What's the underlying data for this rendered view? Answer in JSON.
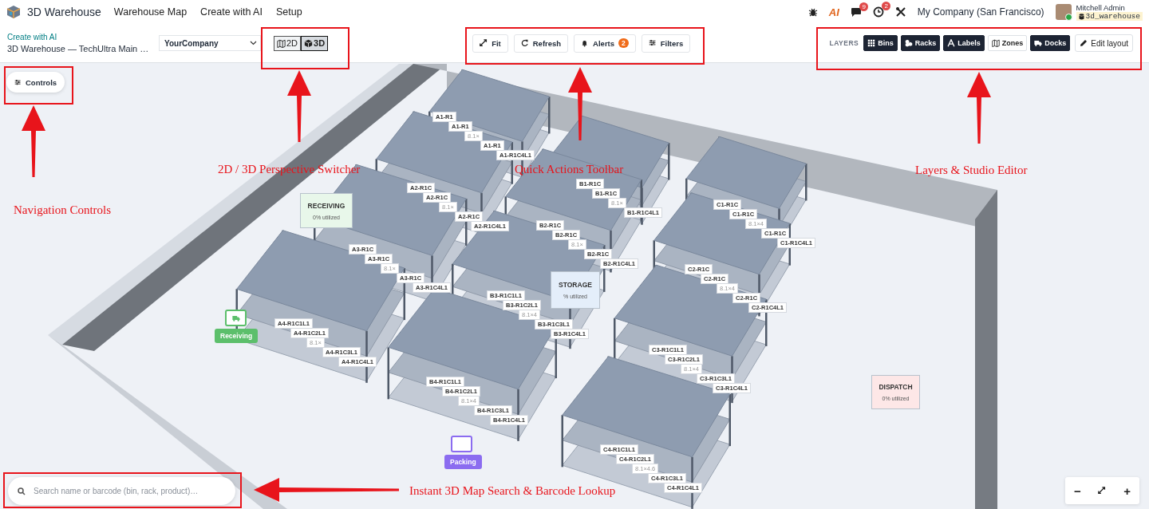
{
  "top_nav": {
    "app_name": "3D Warehouse",
    "menu": [
      {
        "label": "Warehouse Map"
      },
      {
        "label": "Create with AI"
      },
      {
        "label": "Setup"
      }
    ],
    "ai_logo": "AI",
    "messages_badge": "9",
    "activities_badge": "2",
    "company": "My Company (San Francisco)",
    "user_name": "Mitchell Admin",
    "database": "3d_warehouse"
  },
  "control_bar": {
    "breadcrumb": "Create with AI",
    "title": "3D Warehouse — TechUltra Main …",
    "company_select": "YourCompany",
    "view_modes": [
      {
        "label": "2D",
        "kind": "map",
        "selected": false
      },
      {
        "label": "3D",
        "kind": "cube",
        "selected": true
      }
    ],
    "actions": [
      {
        "label": "Fit",
        "kind": "fit"
      },
      {
        "label": "Refresh",
        "kind": "refresh"
      },
      {
        "label": "Alerts",
        "kind": "bell",
        "badge": "2"
      },
      {
        "label": "Filters",
        "kind": "filters"
      }
    ],
    "layers_label": "LAYERS",
    "layers": [
      {
        "label": "Bins",
        "kind": "grid",
        "on": true
      },
      {
        "label": "Racks",
        "kind": "cubes",
        "on": true
      },
      {
        "label": "Labels",
        "kind": "font",
        "on": true
      },
      {
        "label": "Zones",
        "kind": "map",
        "on": false
      },
      {
        "label": "Docks",
        "kind": "truck",
        "on": true
      }
    ],
    "edit_layout": "Edit layout"
  },
  "scene": {
    "controls": "Controls",
    "zones": [
      {
        "name": "RECEIVING",
        "utilization": "0% utilized",
        "color": "#e8f7ea"
      },
      {
        "name": "STORAGE",
        "utilization": "% utilized",
        "color": "#e4eefa"
      },
      {
        "name": "DISPATCH",
        "utilization": "0% utilized",
        "color": "#fde7e7"
      }
    ],
    "docks": [
      {
        "label": "Receiving",
        "kind": "truck",
        "color": "#5cbf6b"
      },
      {
        "label": "Packing",
        "kind": "blank",
        "color": "#8b6cf0"
      }
    ],
    "racks": [
      {
        "labels": [
          {
            "text": "A1-R1",
            "kind": "bin"
          },
          {
            "text": "A1-R1",
            "kind": "bin"
          },
          {
            "text": "8.1×",
            "kind": "size"
          },
          {
            "text": "A1-R1",
            "kind": "bin"
          },
          {
            "text": "A1-R1C4L1",
            "kind": "bin"
          }
        ]
      },
      {
        "labels": [
          {
            "text": "A2-R1C",
            "kind": "bin"
          },
          {
            "text": "A2-R1C",
            "kind": "bin"
          },
          {
            "text": "8.1×",
            "kind": "size"
          },
          {
            "text": "A2-R1C",
            "kind": "bin"
          },
          {
            "text": "A2-R1C4L1",
            "kind": "bin"
          }
        ]
      },
      {
        "labels": [
          {
            "text": "A3-R1C",
            "kind": "bin"
          },
          {
            "text": "A3-R1C",
            "kind": "bin"
          },
          {
            "text": "8.1×",
            "kind": "size"
          },
          {
            "text": "A3-R1C",
            "kind": "bin"
          },
          {
            "text": "A3-R1C4L1",
            "kind": "bin"
          }
        ]
      },
      {
        "labels": [
          {
            "text": "A4-R1C1L1",
            "kind": "bin"
          },
          {
            "text": "A4-R1C2L1",
            "kind": "bin"
          },
          {
            "text": "8.1×",
            "kind": "size"
          },
          {
            "text": "A4-R1C3L1",
            "kind": "bin"
          },
          {
            "text": "A4-R1C4L1",
            "kind": "bin"
          }
        ]
      },
      {
        "labels": [
          {
            "text": "B1-R1C",
            "kind": "bin"
          },
          {
            "text": "B1-R1C",
            "kind": "bin"
          },
          {
            "text": "8.1×",
            "kind": "size"
          },
          {
            "text": "B1-R1C4L1",
            "kind": "bin"
          }
        ]
      },
      {
        "labels": [
          {
            "text": "B2-R1C",
            "kind": "bin"
          },
          {
            "text": "B2-R1C",
            "kind": "bin"
          },
          {
            "text": "8.1×",
            "kind": "size"
          },
          {
            "text": "B2-R1C",
            "kind": "bin"
          },
          {
            "text": "B2-R1C4L1",
            "kind": "bin"
          }
        ]
      },
      {
        "labels": [
          {
            "text": "B3-R1C1L1",
            "kind": "bin"
          },
          {
            "text": "B3-R1C2L1",
            "kind": "bin"
          },
          {
            "text": "8.1×4",
            "kind": "size"
          },
          {
            "text": "B3-R1C3L1",
            "kind": "bin"
          },
          {
            "text": "B3-R1C4L1",
            "kind": "bin"
          }
        ]
      },
      {
        "labels": [
          {
            "text": "B4-R1C1L1",
            "kind": "bin"
          },
          {
            "text": "B4-R1C2L1",
            "kind": "bin"
          },
          {
            "text": "8.1×4",
            "kind": "size"
          },
          {
            "text": "B4-R1C3L1",
            "kind": "bin"
          },
          {
            "text": "B4-R1C4L1",
            "kind": "bin"
          }
        ]
      },
      {
        "labels": [
          {
            "text": "C1-R1C",
            "kind": "bin"
          },
          {
            "text": "C1-R1C",
            "kind": "bin"
          },
          {
            "text": "8.1×4",
            "kind": "size"
          },
          {
            "text": "C1-R1C",
            "kind": "bin"
          },
          {
            "text": "C1-R1C4L1",
            "kind": "bin"
          }
        ]
      },
      {
        "labels": [
          {
            "text": "C2-R1C",
            "kind": "bin"
          },
          {
            "text": "C2-R1C",
            "kind": "bin"
          },
          {
            "text": "8.1×4",
            "kind": "size"
          },
          {
            "text": "C2-R1C",
            "kind": "bin"
          },
          {
            "text": "C2-R1C4L1",
            "kind": "bin"
          }
        ]
      },
      {
        "labels": [
          {
            "text": "C3-R1C1L1",
            "kind": "bin"
          },
          {
            "text": "C3-R1C2L1",
            "kind": "bin"
          },
          {
            "text": "8.1×4",
            "kind": "size"
          },
          {
            "text": "C3-R1C3L1",
            "kind": "bin"
          },
          {
            "text": "C3-R1C4L1",
            "kind": "bin"
          }
        ]
      },
      {
        "labels": [
          {
            "text": "C4-R1C1L1",
            "kind": "bin"
          },
          {
            "text": "C4-R1C2L1",
            "kind": "bin"
          },
          {
            "text": "8.1×4.6",
            "kind": "size"
          },
          {
            "text": "C4-R1C3L1",
            "kind": "bin"
          },
          {
            "text": "C4-R1C4L1",
            "kind": "bin"
          }
        ]
      }
    ],
    "search": {
      "placeholder": "Search name or barcode (bin, rack, product)…"
    },
    "zoom_out": "−",
    "zoom_in": "+"
  },
  "annotations": [
    {
      "text": "Navigation Controls"
    },
    {
      "text": "2D / 3D Perspective Switcher"
    },
    {
      "text": "Quick Actions Toolbar"
    },
    {
      "text": "Layers & Studio Editor"
    },
    {
      "text": "Instant 3D Map Search & Barcode Lookup"
    }
  ]
}
